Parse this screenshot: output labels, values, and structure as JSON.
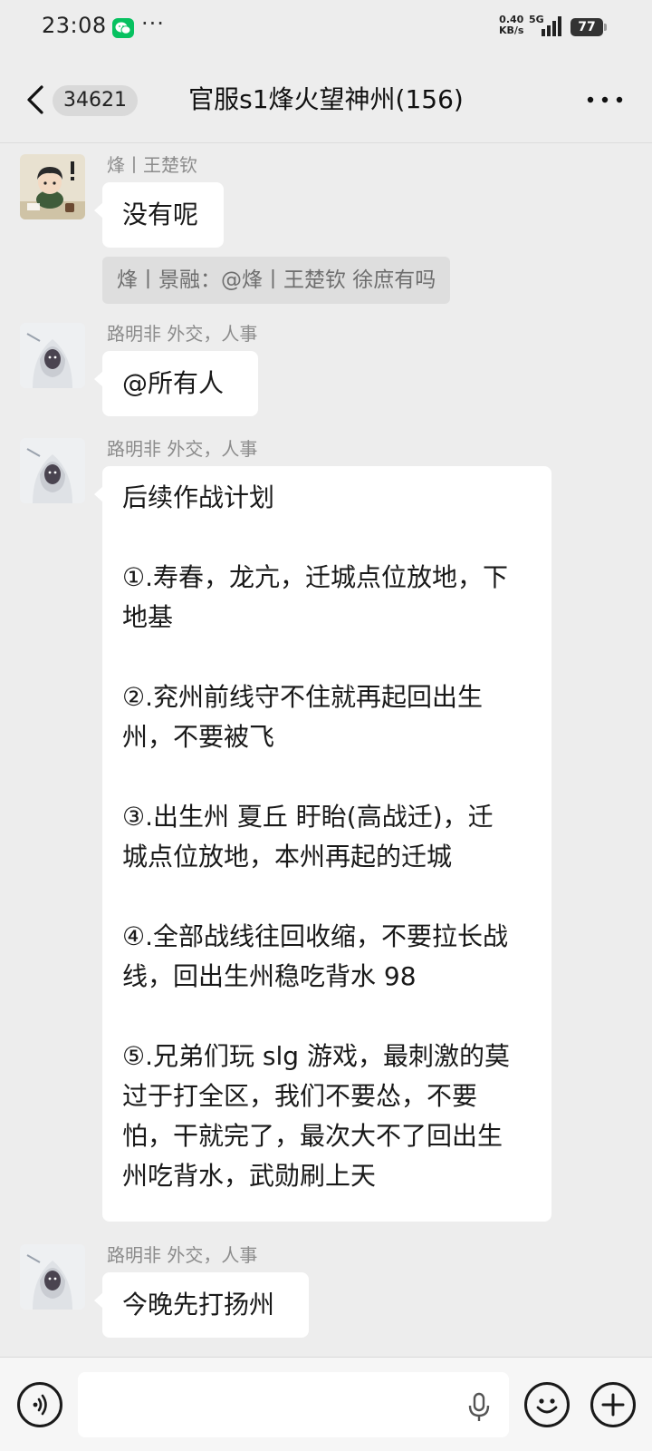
{
  "status_bar": {
    "time": "23:08",
    "net_speed_value": "0.40",
    "net_speed_unit": "KB/s",
    "network": "5G",
    "battery": "77",
    "icons": [
      "wechat-icon",
      "more-dots-icon",
      "signal-icon",
      "battery-icon"
    ]
  },
  "header": {
    "unread_count": "34621",
    "title": "官服s1烽火望神州(156)"
  },
  "messages": [
    {
      "sender": "烽丨王楚钦",
      "text": "没有呢",
      "quote": "烽丨景融：@烽丨王楚钦 徐庶有吗"
    },
    {
      "sender": "路明非 外交，人事",
      "text": "@所有人"
    },
    {
      "sender": "路明非 外交，人事",
      "lines": [
        "后续作战计划",
        "",
        "①.寿春，龙亢，迁城点位放地，下",
        "地基",
        "",
        "②.兖州前线守不住就再起回出生",
        "州，不要被飞",
        "",
        "③.出生州 夏丘 盱眙(高战迁)，迁",
        "城点位放地，本州再起的迁城",
        "",
        "④.全部战线往回收缩，不要拉长战",
        "线，回出生州稳吃背水 98",
        "",
        "⑤.兄弟们玩 slg 游戏，最刺激的莫",
        "过于打全区，我们不要怂，不要",
        "怕，干就完了，最次大不了回出生",
        "州吃背水，武勋刷上天"
      ]
    },
    {
      "sender": "路明非 外交，人事",
      "text": "今晚先打扬州"
    }
  ],
  "input_bar": {
    "value": "",
    "icons": [
      "voice-icon",
      "mic-icon",
      "emoji-icon",
      "plus-icon"
    ]
  },
  "colors": {
    "background": "#ededed",
    "bubble": "#ffffff",
    "quote_bg": "#dedede",
    "wechat_green": "#07c160"
  }
}
